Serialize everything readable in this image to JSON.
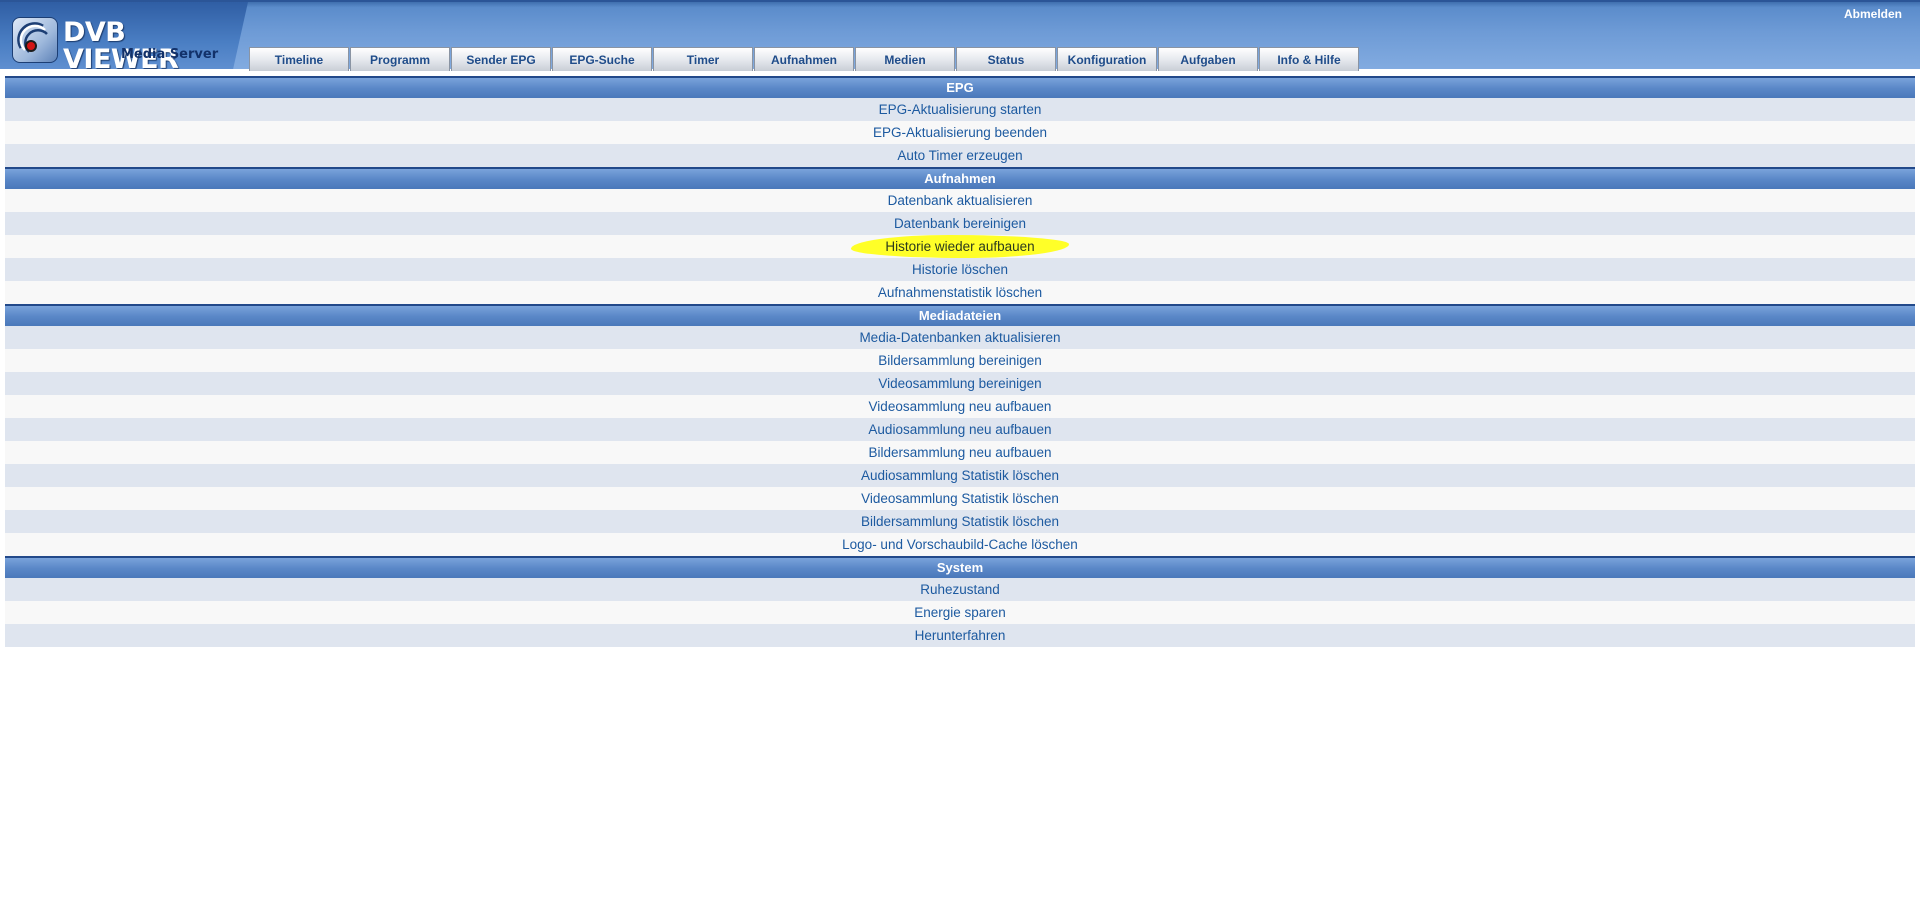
{
  "header": {
    "logo_title": "DVB VIEWER",
    "logo_subtitle": "Media Server",
    "logout_label": "Abmelden",
    "tabs": [
      "Timeline",
      "Programm",
      "Sender EPG",
      "EPG-Suche",
      "Timer",
      "Aufnahmen",
      "Medien",
      "Status",
      "Konfiguration",
      "Aufgaben",
      "Info & Hilfe"
    ]
  },
  "sections": {
    "epg": {
      "title": "EPG",
      "items": [
        "EPG-Aktualisierung starten",
        "EPG-Aktualisierung beenden",
        "Auto Timer erzeugen"
      ]
    },
    "aufnahmen": {
      "title": "Aufnahmen",
      "items": [
        "Datenbank aktualisieren",
        "Datenbank bereinigen",
        "Historie wieder aufbauen",
        "Historie löschen",
        "Aufnahmenstatistik löschen"
      ]
    },
    "mediadateien": {
      "title": "Mediadateien",
      "items": [
        "Media-Datenbanken aktualisieren",
        "Bildersammlung bereinigen",
        "Videosammlung bereinigen",
        "Videosammlung neu aufbauen",
        "Audiosammlung neu aufbauen",
        "Bildersammlung neu aufbauen",
        "Audiosammlung Statistik löschen",
        "Videosammlung Statistik löschen",
        "Bildersammlung Statistik löschen",
        "Logo- und Vorschaubild-Cache löschen"
      ]
    },
    "system": {
      "title": "System",
      "items": [
        "Ruhezustand",
        "Energie sparen",
        "Herunterfahren"
      ]
    }
  },
  "colors": {
    "header_blue": "#5b8ccb",
    "link_blue": "#1d5aa0",
    "row_alt": "#dfe5ef",
    "highlight": "#ffff28"
  }
}
